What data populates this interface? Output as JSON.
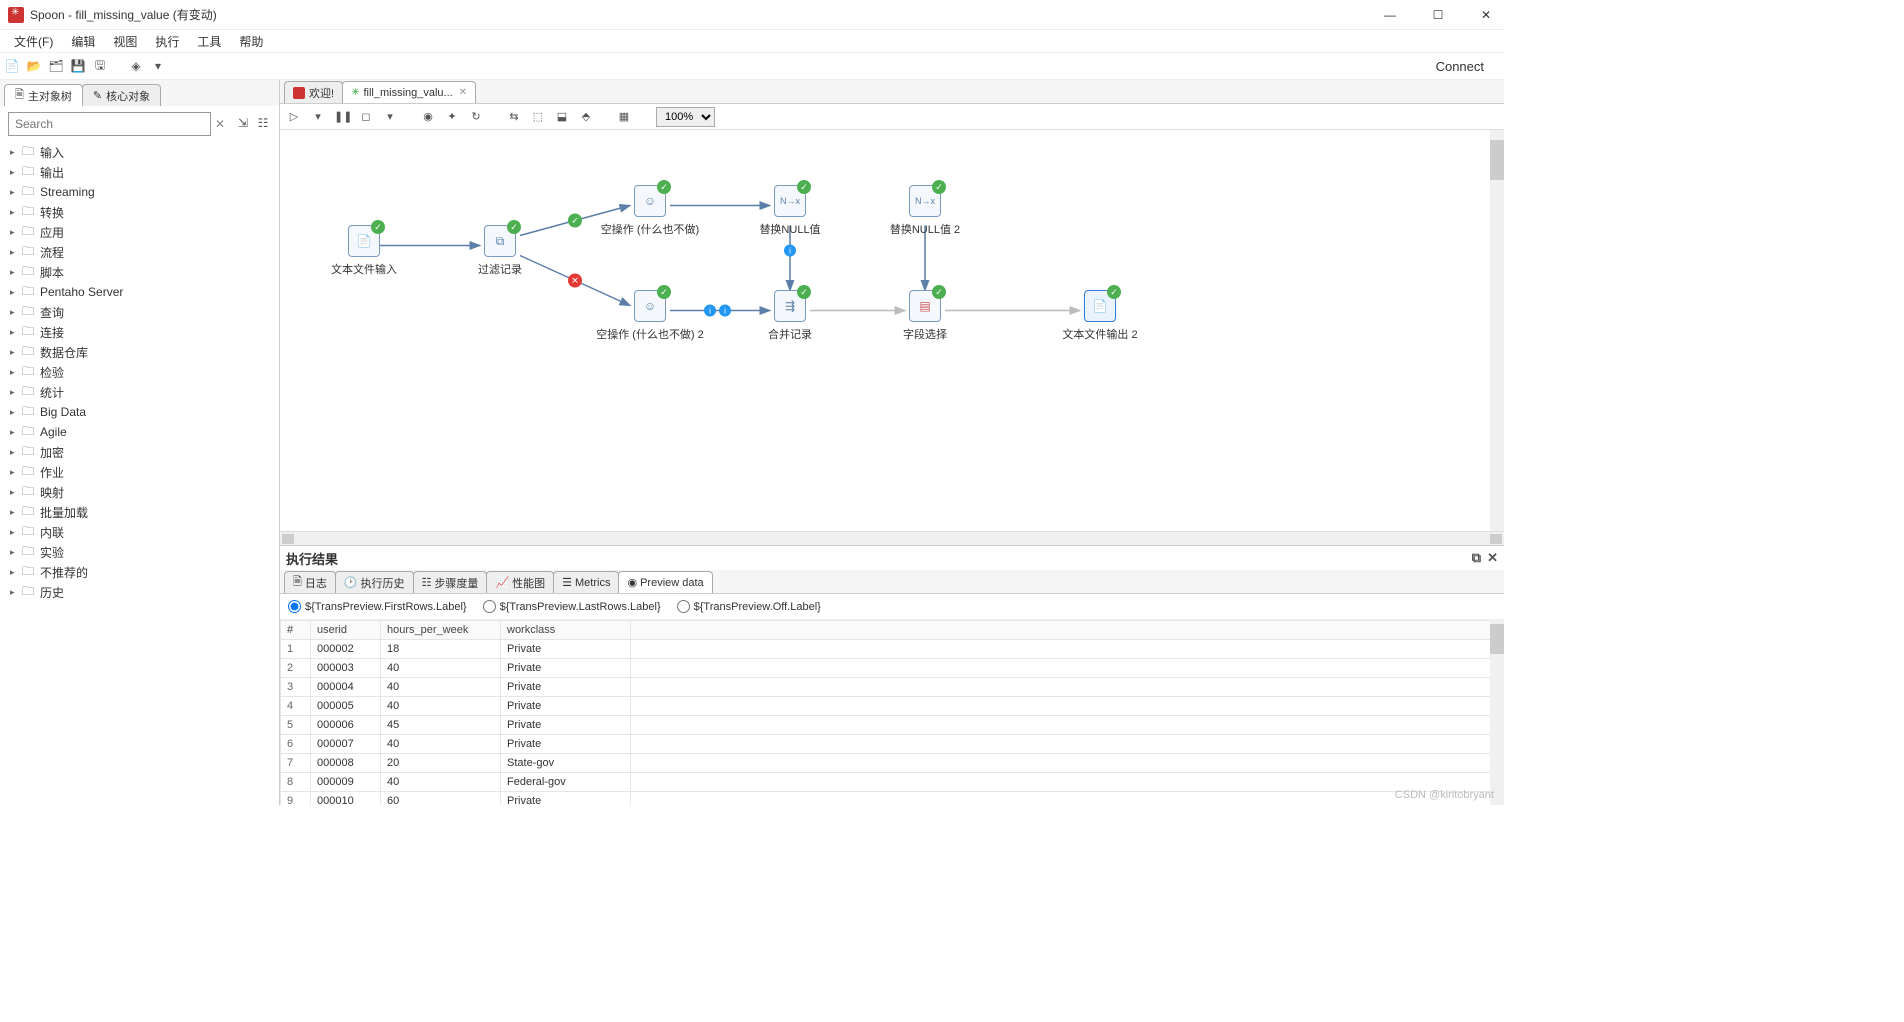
{
  "window": {
    "title": "Spoon - fill_missing_value (有变动)"
  },
  "menu": [
    "文件(F)",
    "编辑",
    "视图",
    "执行",
    "工具",
    "帮助"
  ],
  "connect_label": "Connect",
  "side_tabs": {
    "main": "主对象树",
    "core": "核心对象"
  },
  "search": {
    "placeholder": "Search"
  },
  "tree_items": [
    "输入",
    "输出",
    "Streaming",
    "转换",
    "应用",
    "流程",
    "脚本",
    "Pentaho Server",
    "查询",
    "连接",
    "数据仓库",
    "检验",
    "统计",
    "Big Data",
    "Agile",
    "加密",
    "作业",
    "映射",
    "批量加载",
    "内联",
    "实验",
    "不推荐的",
    "历史"
  ],
  "file_tabs": {
    "welcome": "欢迎!",
    "trans": "fill_missing_valu..."
  },
  "zoom": "100%",
  "nodes": {
    "n1": "文本文件输入",
    "n2": "过滤记录",
    "n3": "空操作 (什么也不做)",
    "n4": "替换NULL值",
    "n5": "替换NULL值 2",
    "n6": "空操作 (什么也不做) 2",
    "n7": "合并记录",
    "n8": "字段选择",
    "n9": "文本文件输出 2"
  },
  "exec": {
    "title": "执行结果",
    "tabs": [
      "日志",
      "执行历史",
      "步骤度量",
      "性能图",
      "Metrics",
      "Preview data"
    ],
    "radios": [
      "${TransPreview.FirstRows.Label}",
      "${TransPreview.LastRows.Label}",
      "${TransPreview.Off.Label}"
    ]
  },
  "table": {
    "headers": [
      "#",
      "userid",
      "hours_per_week",
      "workclass"
    ],
    "rows": [
      [
        "1",
        "000002",
        "18",
        "Private"
      ],
      [
        "2",
        "000003",
        "40",
        "Private"
      ],
      [
        "3",
        "000004",
        "40",
        "Private"
      ],
      [
        "4",
        "000005",
        "40",
        "Private"
      ],
      [
        "5",
        "000006",
        "45",
        "Private"
      ],
      [
        "6",
        "000007",
        "40",
        "Private"
      ],
      [
        "7",
        "000008",
        "20",
        "State-gov"
      ],
      [
        "8",
        "000009",
        "40",
        "Federal-gov"
      ],
      [
        "9",
        "000010",
        "60",
        "Private"
      ]
    ]
  },
  "watermark": "CSDN @kiritobryant"
}
